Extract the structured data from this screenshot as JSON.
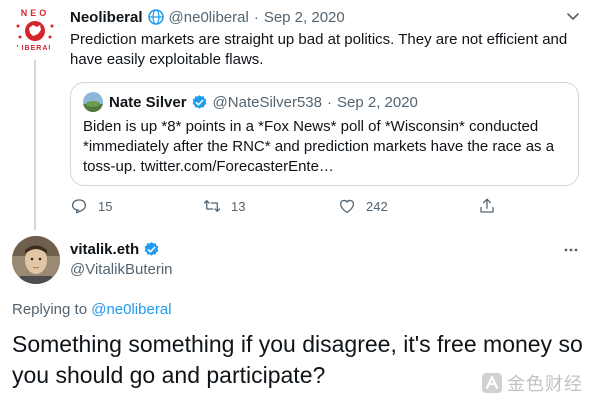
{
  "tweet": {
    "author_name": "Neoliberal",
    "author_handle": "@ne0liberal",
    "separator": "·",
    "date": "Sep 2, 2020",
    "text": "Prediction markets are straight up bad at politics. They are not efficient and have easily exploitable flaws.",
    "avatar_logo_text": "NEO LIBERAL",
    "quote": {
      "author_name": "Nate Silver",
      "author_handle": "@NateSilver538",
      "separator": "·",
      "date": "Sep 2, 2020",
      "text": "Biden is up *8* points in a *Fox News* poll of *Wisconsin* conducted *immediately after the RNC* and prediction markets have the race as a toss-up. twitter.com/ForecasterEnte…"
    },
    "actions": {
      "replies": "15",
      "retweets": "13",
      "likes": "242"
    }
  },
  "reply": {
    "author_name": "vitalik.eth",
    "author_handle": "@VitalikButerin",
    "replying_prefix": "Replying to",
    "replying_to": "@ne0liberal",
    "text": "Something something if you disagree, it's free money so you should go and participate?"
  },
  "watermark": {
    "text": "金色财经"
  },
  "colors": {
    "text": "#0f1419",
    "secondary": "#536471",
    "accent": "#1d9bf0",
    "border": "#cfd9de",
    "neoliberal_red": "#d5242c"
  }
}
